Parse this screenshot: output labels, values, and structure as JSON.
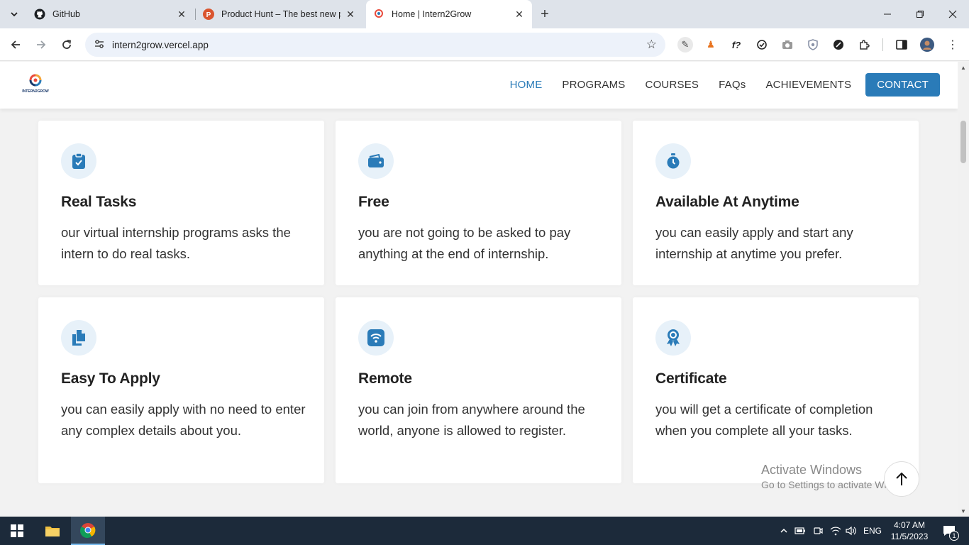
{
  "browser": {
    "tabs": [
      {
        "title": "GitHub",
        "favicon": "github-icon"
      },
      {
        "title": "Product Hunt – The best new p",
        "favicon": "product-hunt-icon"
      },
      {
        "title": "Home | Intern2Grow",
        "favicon": "intern2grow-icon"
      }
    ],
    "url": "intern2grow.vercel.app"
  },
  "site": {
    "logo_text": "INTERN2GROW",
    "nav": [
      {
        "label": "HOME"
      },
      {
        "label": "PROGRAMS"
      },
      {
        "label": "COURSES"
      },
      {
        "label": "FAQs"
      },
      {
        "label": "ACHIEVEMENTS"
      }
    ],
    "contact_label": "CONTACT",
    "accent_color": "#2a7bb8",
    "features": [
      {
        "title": "Real Tasks",
        "text": "our virtual internship programs asks the intern to do real tasks.",
        "icon": "clipboard-check-icon"
      },
      {
        "title": "Free",
        "text": "you are not going to be asked to pay anything at the end of internship.",
        "icon": "wallet-icon"
      },
      {
        "title": "Available At Anytime",
        "text": "you can easily apply and start any internship at anytime you prefer.",
        "icon": "stopwatch-icon"
      },
      {
        "title": "Easy To Apply",
        "text": "you can easily apply with no need to enter any complex details about you.",
        "icon": "documents-icon"
      },
      {
        "title": "Remote",
        "text": "you can join from anywhere around the world, anyone is allowed to register.",
        "icon": "wifi-icon"
      },
      {
        "title": "Certificate",
        "text": "you will get a certificate of completion when you complete all your tasks.",
        "icon": "award-icon"
      }
    ]
  },
  "watermark": {
    "line1": "Activate Windows",
    "line2": "Go to Settings to activate Windows."
  },
  "taskbar": {
    "language": "ENG",
    "time": "4:07 AM",
    "date": "11/5/2023",
    "notification_count": "1"
  }
}
